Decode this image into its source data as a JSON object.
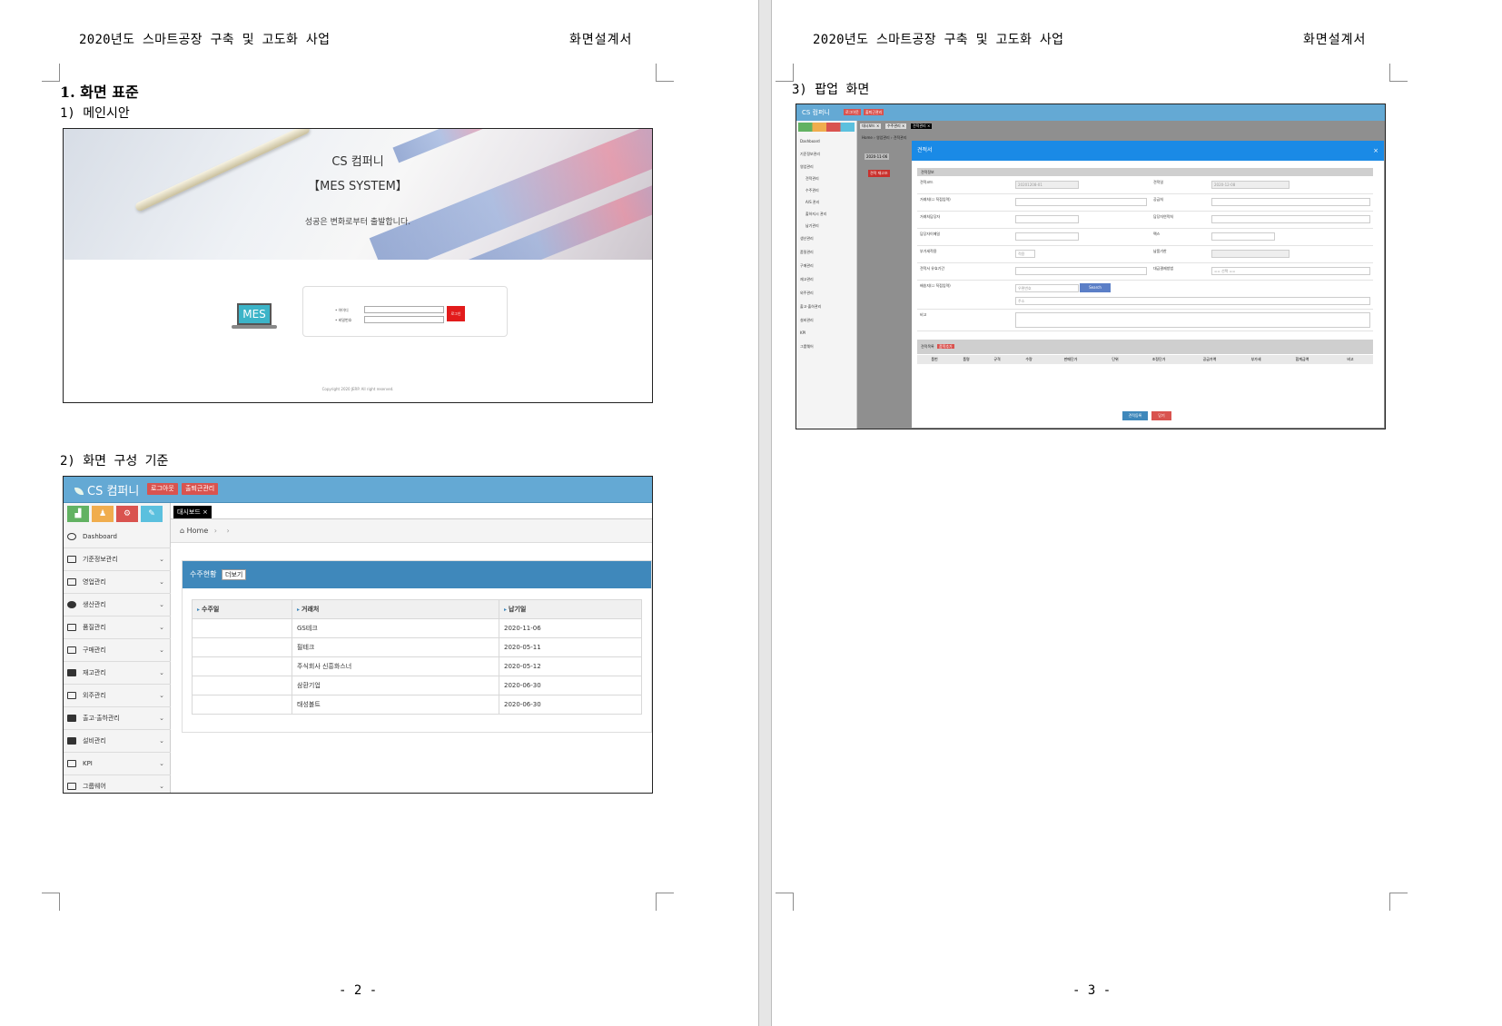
{
  "header": {
    "project_title": "2020년도 스마트공장 구축 및 고도화 사업",
    "doc_type": "화면설계서"
  },
  "page2": {
    "section_title": "1. 화면 표준",
    "sub1_title": "1) 메인시안",
    "sub2_title": "2) 화면 구성 기준",
    "page_number": "- 2 -",
    "login": {
      "company": "CS 컴퍼니",
      "system": "【MES SYSTEM】",
      "slogan": "성공은 변화로부터 출발합니다.",
      "id_label": "• 아이디",
      "pw_label": "• 비밀번호",
      "login_button": "로그인",
      "logo_text": "MES",
      "copyright": "Copyright 2020 JERP. All right reserved."
    },
    "dashboard": {
      "brand": "CS 컴퍼니",
      "logout_btn": "로그아웃",
      "attendance_btn": "출퇴근관리",
      "quick_icons": [
        "chart-icon",
        "users-icon",
        "gears-icon",
        "pencil-icon"
      ],
      "active_tab": "대시보드 ×",
      "breadcrumb_home": "Home",
      "breadcrumb_sep": "›",
      "sidebar": [
        {
          "label": "Dashboard",
          "icon": "dashboard-icon"
        },
        {
          "label": "기준정보관리",
          "icon": "monitor-icon"
        },
        {
          "label": "영업관리",
          "icon": "edit-icon"
        },
        {
          "label": "생산관리",
          "icon": "gear-icon"
        },
        {
          "label": "품질관리",
          "icon": "calendar-icon"
        },
        {
          "label": "구매관리",
          "icon": "basket-icon"
        },
        {
          "label": "재고관리",
          "icon": "grid-icon"
        },
        {
          "label": "외주관리",
          "icon": "copy-icon"
        },
        {
          "label": "출고·출하관리",
          "icon": "truck-icon"
        },
        {
          "label": "설비관리",
          "icon": "factory-icon"
        },
        {
          "label": "KPI",
          "icon": "edit-icon"
        },
        {
          "label": "그룹웨어",
          "icon": "card-icon"
        }
      ],
      "panel_title": "수주현황",
      "more_btn": "더보기",
      "columns": [
        "수주일",
        "거래처",
        "납기일"
      ],
      "rows": [
        [
          "",
          "GS테크",
          "2020-11-06"
        ],
        [
          "",
          "필테크",
          "2020-05-11"
        ],
        [
          "",
          "주식회사 신흥화스너",
          "2020-05-12"
        ],
        [
          "",
          "삼환기업",
          "2020-06-30"
        ],
        [
          "",
          "태성볼트",
          "2020-06-30"
        ]
      ]
    }
  },
  "page3": {
    "sub3_title": "3) 팝업 화면",
    "page_number": "- 3 -",
    "popup": {
      "brand": "CS 컴퍼니",
      "logout_btn": "로그아웃",
      "attendance_btn": "출퇴근관리",
      "tabs": [
        "대시보드 ×",
        "수주관리 ×",
        "견적관리 ×"
      ],
      "breadcrumb": "Home › 영업관리 › 견적관리",
      "bg_date": "2020-11-06",
      "bg_btn": "견적 재고조",
      "side_items": [
        "Dashboard",
        "기준정보관리",
        "영업관리",
        "견적관리",
        "수주관리",
        "A/S 관리",
        "출하지시 관리",
        "납기관리",
        "생산관리",
        "품질관리",
        "구매관리",
        "재고관리",
        "외주관리",
        "출고·출하관리",
        "설비관리",
        "KPI",
        "그룹웨어"
      ],
      "modal_title": "견적서",
      "section_info": "견적정보",
      "fields": {
        "quote_code_label": "견적코드",
        "quote_code_value": "20201208-01",
        "quote_date_label": "견적일",
        "quote_date_value": "2020-12-08",
        "client_label": "거래처(☐ 직접입력)",
        "supplier_label": "공급처",
        "client_manager_label": "거래처담당자",
        "sales_manager_label": "담당자연락처",
        "manager_email_label": "담당자이메일",
        "fax_label": "팩스",
        "vat_label": "부가세적용",
        "vat_value": "적용",
        "delivery_label": "납품기한",
        "valid_label": "견적서 유효기간",
        "payment_label": "대금결제방법",
        "payment_value": "== 선택 ==",
        "ship_label": "배송지(☐ 직접입력)",
        "zip_placeholder": "우편번호",
        "search_btn": "Search",
        "addr_placeholder": "주소",
        "memo_label": "비고"
      },
      "section_items": "견적목록",
      "add_item_btn": "품목추가",
      "item_columns": [
        "품번",
        "품명",
        "규격",
        "수량",
        "판매단가",
        "단위",
        "조정단가",
        "공급가액",
        "부가세",
        "합계금액",
        "비고"
      ],
      "save_btn": "견적등록",
      "close_btn": "닫기"
    }
  }
}
